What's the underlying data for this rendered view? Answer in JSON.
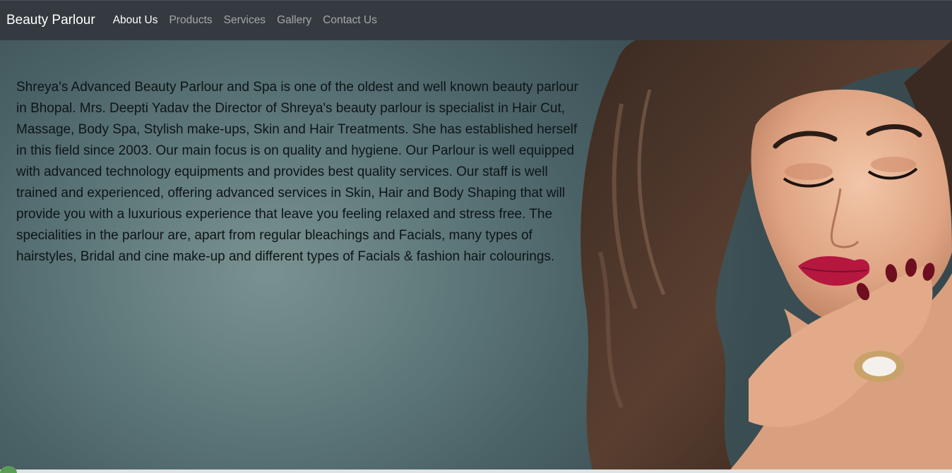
{
  "navbar": {
    "brand": "Beauty Parlour",
    "links": [
      {
        "label": "About Us",
        "active": true
      },
      {
        "label": "Products",
        "active": false
      },
      {
        "label": "Services",
        "active": false
      },
      {
        "label": "Gallery",
        "active": false
      },
      {
        "label": "Contact Us",
        "active": false
      }
    ]
  },
  "about": {
    "text": "Shreya's Advanced Beauty Parlour and Spa is one of the oldest and well known beauty parlour in Bhopal. Mrs. Deepti Yadav the Director of Shreya's beauty parlour is specialist in Hair Cut, Massage, Body Spa, Stylish make-ups, Skin and Hair Treatments. She has established herself in this field since 2003. Our main focus is on quality and hygiene. Our Parlour is well equipped with advanced technology equipments and provides best quality services. Our staff is well trained and experienced, offering advanced services in Skin, Hair and Body Shaping that will provide you with a luxurious experience that leave you feeling relaxed and stress free. The specialities in the parlour are, apart from regular bleachings and Facials, many types of hairstyles, Bridal and cine make-up and different types of Facials & fashion hair colourings."
  },
  "colors": {
    "navbar_bg": "#343a40",
    "nav_active": "#ffffff",
    "nav_inactive": "rgba(255,255,255,0.55)",
    "hero_text": "#0e1416"
  }
}
